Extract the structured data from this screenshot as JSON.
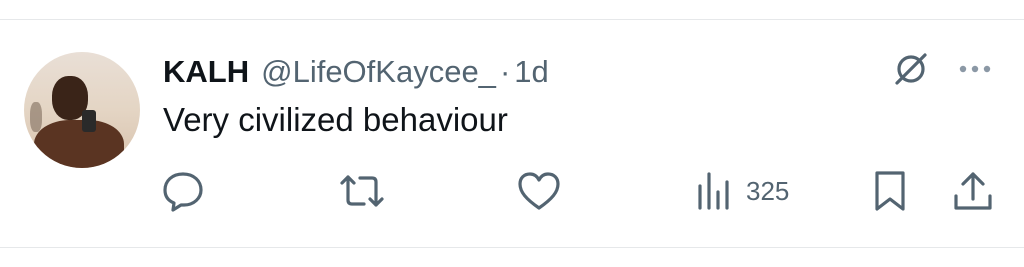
{
  "tweet": {
    "display_name": "KALH",
    "handle": "@LifeOfKaycee_",
    "separator": "·",
    "time": "1d",
    "text": "Very civilized behaviour"
  },
  "actions": {
    "views_count": "325"
  },
  "icons": {
    "avatar": "profile-photo",
    "grok": "grok-slash-icon",
    "more": "more-dots-icon",
    "reply": "reply-bubble-icon",
    "retweet": "retweet-icon",
    "like": "heart-icon",
    "views": "bar-chart-icon",
    "bookmark": "bookmark-icon",
    "share": "share-upload-icon"
  },
  "colors": {
    "text": "#0f1419",
    "secondary": "#536471",
    "divider": "#e6e8ea"
  }
}
